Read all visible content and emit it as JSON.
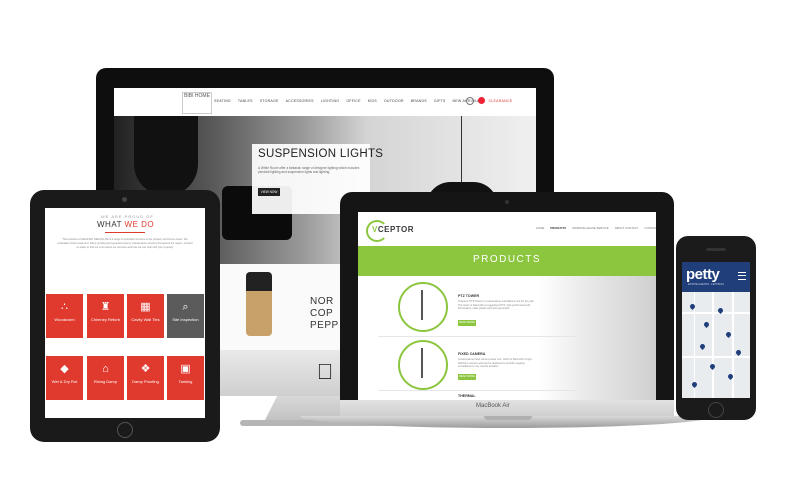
{
  "imac": {
    "site": {
      "logo": "BIBI HOME",
      "nav": [
        "SEATING",
        "TABLES",
        "STORAGE",
        "ACCESSORIES",
        "LIGHTING",
        "OFFICE",
        "KIDS",
        "OUTDOOR",
        "BRANDS",
        "GIFTS",
        "NEW ARRIVALS"
      ],
      "nav_highlight": "CLEARANCE",
      "hero_title": "SUSPENSION LIGHTS",
      "hero_text": "A White Room offer a fantastic range of designer lighting which includes pendant lighting and suspension lights and lighting.",
      "hero_button": "VIEW NOW",
      "lower_text": [
        "NOR",
        "COP",
        "PEPP"
      ]
    },
    "apple_glyph": ""
  },
  "ipad": {
    "eyebrow": "WE ARE PROUD OF",
    "heading_part1": "WHAT",
    "heading_part2": "WE DO",
    "paragraph": "The business of GRAPHIC DESIGN offers a range of specialist services to the property and home owner. We undertake timber treatment, damp proofing and general property maintenance services throughout the region. Contact us today to find out more about our services and how we can help with your property.",
    "tiles": [
      {
        "label": "Woodworm",
        "icon": "dots-icon",
        "glyph": "∴",
        "color": "#e03a2f"
      },
      {
        "label": "Chimney Refurb",
        "icon": "chimney-icon",
        "glyph": "♜",
        "color": "#e03a2f"
      },
      {
        "label": "Cavity Wall Ties",
        "icon": "wall-icon",
        "glyph": "▦",
        "color": "#e03a2f"
      },
      {
        "label": "Site Inspection",
        "icon": "magnifier-icon",
        "glyph": "⌕",
        "color": "#5b5b5b"
      },
      {
        "label": "Wet & Dry Rot",
        "icon": "drop-icon",
        "glyph": "◆",
        "color": "#e03a2f"
      },
      {
        "label": "Rising Damp",
        "icon": "house-icon",
        "glyph": "⌂",
        "color": "#e03a2f"
      },
      {
        "label": "Damp Proofing",
        "icon": "shield-icon",
        "glyph": "❖",
        "color": "#e03a2f"
      },
      {
        "label": "Tanking",
        "icon": "bucket-icon",
        "glyph": "▣",
        "color": "#e03a2f"
      }
    ]
  },
  "macbook": {
    "label": "MacBook Air",
    "site": {
      "logo_v": "V",
      "logo_rest": "CEPTOR",
      "nav": [
        "HOME",
        "PRODUCTS",
        "INTERNAL/LEASE SERVICE",
        "ABOUT CONTACT",
        "CONTACT"
      ],
      "nav_active": "PRODUCTS",
      "banner_title": "PRODUCTS",
      "products": [
        {
          "title": "PTZ TOWER",
          "text": "Vceptor's PTZ Tower is a stand-alone surveillance unit for any site. The tower is fitted with a ruggedised PTZ, high performance IR illuminators, solar panels and wind generator.",
          "button": "READ MORE"
        },
        {
          "title": "FIXED CAMERA",
          "text": "A stand-alone fixed camera tower unit, which is fitted with a high-definition camera and can be deployed to provide ongoing surveillance to any remote location.",
          "button": "READ MORE"
        },
        {
          "title": "THERMAL",
          "text": "",
          "button": ""
        }
      ]
    }
  },
  "iphone": {
    "logo": "petty",
    "subtitle": "ESTATE AGENTS · LETTINGS",
    "map_pins": 9
  }
}
